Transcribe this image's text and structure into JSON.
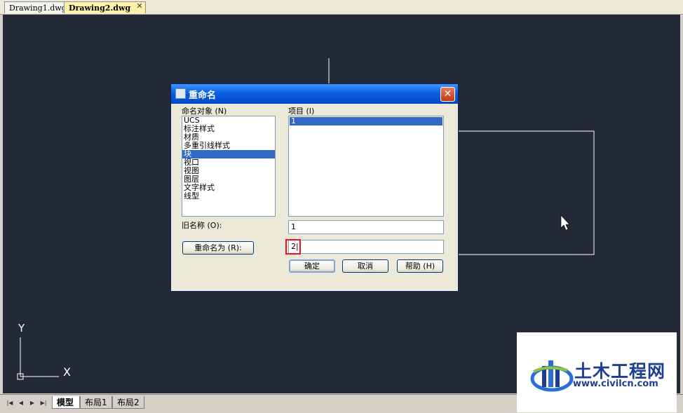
{
  "doc_tabs": [
    {
      "label": "Drawing1.dwg",
      "active": false
    },
    {
      "label": "Drawing2.dwg",
      "active": true
    }
  ],
  "doc_tab_close": "✕",
  "canvas": {
    "background": "#232a35",
    "ucs_x_label": "X",
    "ucs_y_label": "Y"
  },
  "layout_tabs": [
    {
      "label": "模型",
      "active": true
    },
    {
      "label": "布局1",
      "active": false
    },
    {
      "label": "布局2",
      "active": false
    }
  ],
  "dialog": {
    "title": "重命名",
    "close_label": "✕",
    "named_objects_label": "命名对象 (N)",
    "named_objects": [
      "UCS",
      "标注样式",
      "材质",
      "多重引线样式",
      "块",
      "视口",
      "视图",
      "图层",
      "文字样式",
      "线型"
    ],
    "selected_object": "块",
    "items_label": "项目 (I)",
    "items": [
      "1"
    ],
    "selected_item": "1",
    "old_name_label": "旧名称 (O):",
    "old_name_value": "1",
    "rename_to_button": "重命名为 (R):",
    "rename_to_value": "2|",
    "ok_button": "确定",
    "cancel_button": "取消",
    "help_button": "帮助 (H)"
  },
  "watermark": {
    "site_name": "土木工程网",
    "url": "www.civilcn.com"
  }
}
